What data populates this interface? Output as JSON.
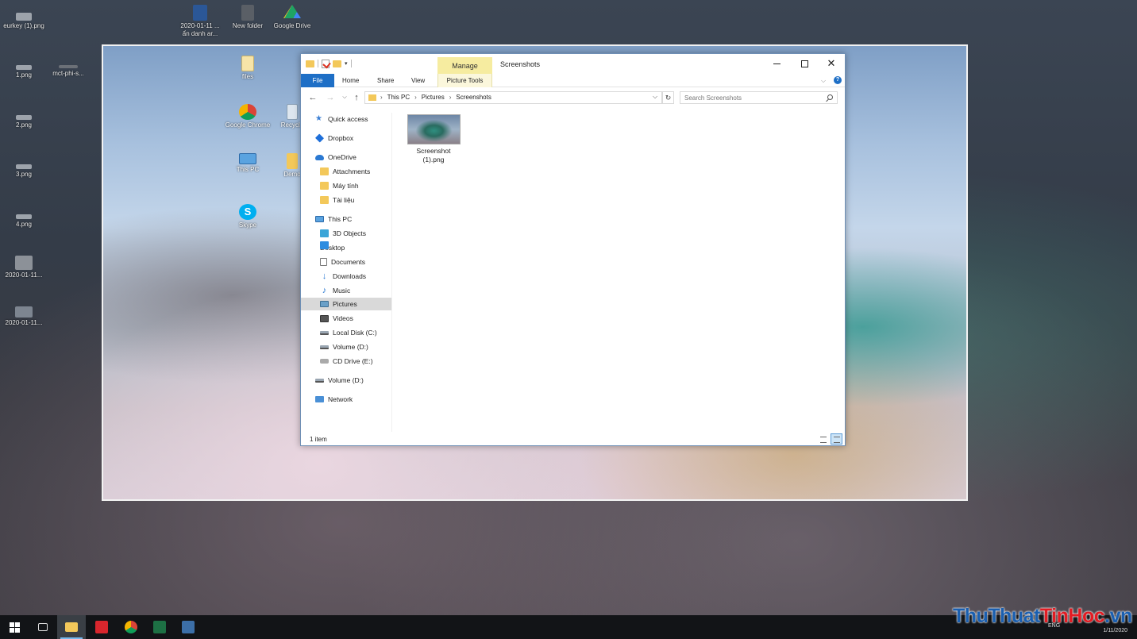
{
  "desktop": {
    "left_icons": [
      {
        "label": "eurkey (1).png",
        "icon": "image-file-icon"
      },
      {
        "label": "mct-phi-s...",
        "icon": "image-file-icon"
      },
      {
        "label": "1.png",
        "icon": "image-file-icon"
      },
      {
        "label": "2.png",
        "icon": "image-file-icon"
      },
      {
        "label": "3.png",
        "icon": "image-file-icon"
      },
      {
        "label": "4.png",
        "icon": "image-file-icon"
      },
      {
        "label": "2020-01-11...",
        "icon": "image-file-icon"
      },
      {
        "label": "2020-01-11...",
        "icon": "image-file-icon"
      }
    ],
    "top_icons": [
      {
        "label": "2020-01-11 ... ẩn danh ar...",
        "icon": "word-doc-icon"
      },
      {
        "label": "New folder",
        "icon": "folder-icon"
      },
      {
        "label": "Google Drive",
        "icon": "google-drive-icon"
      }
    ],
    "inner_icons": [
      {
        "label": "files",
        "icon": "zip-folder-icon"
      },
      {
        "label": "Google Chrome",
        "icon": "chrome-icon"
      },
      {
        "label": "Recycle",
        "icon": "recycle-bin-icon"
      },
      {
        "label": "This PC",
        "icon": "this-pc-icon"
      },
      {
        "label": "Demo",
        "icon": "folder-icon"
      },
      {
        "label": "Skype",
        "icon": "skype-icon"
      }
    ]
  },
  "explorer": {
    "title": "Screenshots",
    "manage_tab": "Manage",
    "ribbon_tabs": {
      "file": "File",
      "home": "Home",
      "share": "Share",
      "view": "View",
      "picture_tools": "Picture Tools"
    },
    "breadcrumb": [
      "This PC",
      "Pictures",
      "Screenshots"
    ],
    "search_placeholder": "Search Screenshots",
    "nav_items": [
      {
        "label": "Quick access",
        "icon": "star-icon"
      },
      {
        "label": "Dropbox",
        "icon": "dropbox-icon"
      },
      {
        "label": "OneDrive",
        "icon": "onedrive-icon"
      },
      {
        "label": "Attachments",
        "icon": "folder-icon"
      },
      {
        "label": "Máy tính",
        "icon": "folder-icon"
      },
      {
        "label": "Tài liệu",
        "icon": "folder-icon"
      },
      {
        "label": "This PC",
        "icon": "this-pc-icon"
      },
      {
        "label": "3D Objects",
        "icon": "3d-objects-icon"
      },
      {
        "label": "Desktop",
        "icon": "desktop-icon"
      },
      {
        "label": "Documents",
        "icon": "documents-icon"
      },
      {
        "label": "Downloads",
        "icon": "downloads-icon"
      },
      {
        "label": "Music",
        "icon": "music-icon"
      },
      {
        "label": "Pictures",
        "icon": "pictures-icon",
        "selected": true
      },
      {
        "label": "Videos",
        "icon": "videos-icon"
      },
      {
        "label": "Local Disk (C:)",
        "icon": "local-disk-icon"
      },
      {
        "label": "Volume (D:)",
        "icon": "drive-icon"
      },
      {
        "label": "CD Drive (E:)",
        "icon": "cd-drive-icon"
      },
      {
        "label": "Volume (D:)",
        "icon": "drive-icon"
      },
      {
        "label": "Network",
        "icon": "network-icon"
      }
    ],
    "files": [
      {
        "name": "Screenshot (1).png",
        "icon": "image-thumbnail"
      }
    ],
    "status": "1 item"
  },
  "taskbar": {
    "apps": [
      "start-icon",
      "task-view-icon",
      "file-explorer-icon",
      "pin-app-icon",
      "chrome-icon",
      "excel-icon",
      "app-s-icon"
    ],
    "lang": "ENG",
    "date": "1/11/2020"
  },
  "watermark": {
    "part1": "ThuThuat",
    "part2": "TinHoc",
    "part3": ".vn"
  },
  "colors": {
    "accent": "#1e6fc6",
    "manage_tab": "#f6eca0",
    "selected_nav": "#d9d9d9"
  }
}
